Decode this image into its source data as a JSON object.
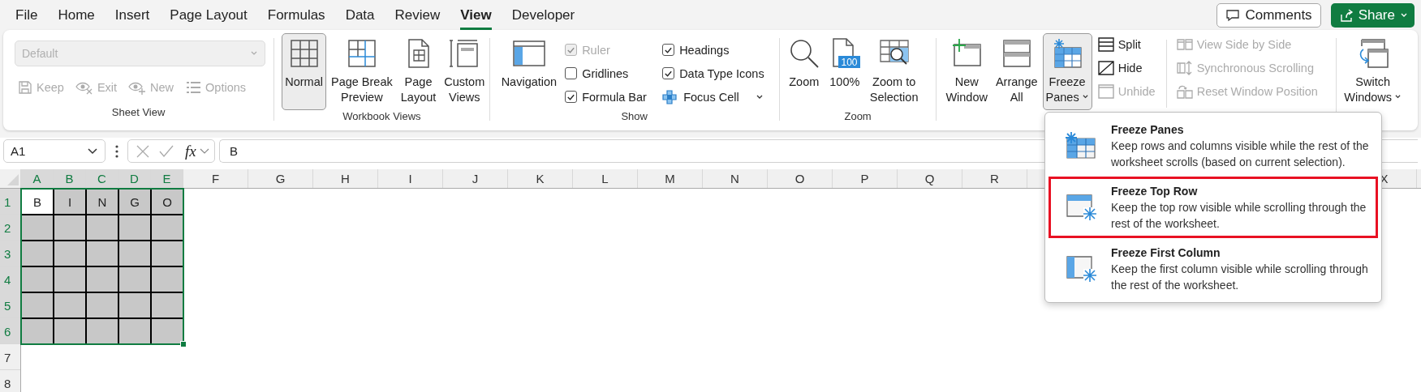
{
  "menu_tabs": [
    {
      "label": "File",
      "selected": false
    },
    {
      "label": "Home",
      "selected": false
    },
    {
      "label": "Insert",
      "selected": false
    },
    {
      "label": "Page Layout",
      "selected": false
    },
    {
      "label": "Formulas",
      "selected": false
    },
    {
      "label": "Data",
      "selected": false
    },
    {
      "label": "Review",
      "selected": false
    },
    {
      "label": "View",
      "selected": true
    },
    {
      "label": "Developer",
      "selected": false
    }
  ],
  "comments_button": {
    "label": "Comments"
  },
  "share_button": {
    "label": "Share"
  },
  "ribbon": {
    "sheet_view": {
      "label": "Sheet View",
      "dropdown": {
        "value": "Default",
        "disabled": true
      },
      "buttons": [
        {
          "label": "Keep",
          "disabled": true
        },
        {
          "label": "Exit",
          "disabled": true
        },
        {
          "label": "New",
          "disabled": true
        },
        {
          "label": "Options",
          "disabled": true
        }
      ]
    },
    "workbook_views": {
      "label": "Workbook Views",
      "buttons": [
        {
          "label": "Normal",
          "selected": true
        },
        {
          "label": "Page Break\nPreview",
          "selected": false
        },
        {
          "label": "Page\nLayout",
          "selected": false
        },
        {
          "label": "Custom\nViews",
          "selected": false
        }
      ]
    },
    "show": {
      "label": "Show",
      "navigation": {
        "label": "Navigation"
      },
      "checkboxes": [
        {
          "label": "Ruler",
          "checked": true,
          "disabled": true
        },
        {
          "label": "Gridlines",
          "checked": false,
          "disabled": false
        },
        {
          "label": "Formula Bar",
          "checked": true,
          "disabled": false
        },
        {
          "label": "Headings",
          "checked": true,
          "disabled": false
        },
        {
          "label": "Data Type Icons",
          "checked": true,
          "disabled": false
        }
      ],
      "focus_cell": {
        "label": "Focus Cell"
      }
    },
    "zoom": {
      "label": "Zoom",
      "buttons": [
        {
          "label": "Zoom"
        },
        {
          "label": "100%",
          "badge": "100"
        },
        {
          "label": "Zoom to\nSelection"
        }
      ]
    },
    "window": {
      "big_buttons": [
        {
          "label": "New\nWindow",
          "selected": false
        },
        {
          "label": "Arrange\nAll",
          "selected": false
        },
        {
          "label": "Freeze\nPanes",
          "selected": true
        }
      ],
      "small_buttons": [
        {
          "label": "Split",
          "disabled": false
        },
        {
          "label": "Hide",
          "disabled": false
        },
        {
          "label": "Unhide",
          "disabled": true
        },
        {
          "label": "View Side by Side",
          "disabled": true
        },
        {
          "label": "Synchronous Scrolling",
          "disabled": true
        },
        {
          "label": "Reset Window Position",
          "disabled": true
        }
      ],
      "switch_windows": {
        "label": "Switch\nWindows"
      }
    }
  },
  "formula_bar": {
    "name_box": "A1",
    "function_label": "fx",
    "formula": "B"
  },
  "sheet": {
    "columns": [
      {
        "label": "A",
        "selected": true
      },
      {
        "label": "B",
        "selected": true
      },
      {
        "label": "C",
        "selected": true
      },
      {
        "label": "D",
        "selected": true
      },
      {
        "label": "E",
        "selected": true
      },
      {
        "label": "F",
        "selected": false
      },
      {
        "label": "G",
        "selected": false
      },
      {
        "label": "H",
        "selected": false
      },
      {
        "label": "I",
        "selected": false
      },
      {
        "label": "J",
        "selected": false
      },
      {
        "label": "K",
        "selected": false
      },
      {
        "label": "L",
        "selected": false
      },
      {
        "label": "M",
        "selected": false
      },
      {
        "label": "N",
        "selected": false
      },
      {
        "label": "O",
        "selected": false
      },
      {
        "label": "P",
        "selected": false
      },
      {
        "label": "Q",
        "selected": false
      },
      {
        "label": "R",
        "selected": false
      },
      {
        "label": "X",
        "selected": false
      }
    ],
    "rows": [
      {
        "label": "1",
        "selected": true,
        "cells": [
          {
            "value": "B",
            "active": true
          },
          {
            "value": "I",
            "active": false
          },
          {
            "value": "N",
            "active": false
          },
          {
            "value": "G",
            "active": false
          },
          {
            "value": "O",
            "active": false
          }
        ]
      },
      {
        "label": "2",
        "selected": true,
        "cells": [
          {
            "active": false
          },
          {
            "active": false
          },
          {
            "active": false
          },
          {
            "active": false
          },
          {
            "active": false
          }
        ]
      },
      {
        "label": "3",
        "selected": true,
        "cells": [
          {
            "active": false
          },
          {
            "active": false
          },
          {
            "active": false
          },
          {
            "active": false
          },
          {
            "active": false
          }
        ]
      },
      {
        "label": "4",
        "selected": true,
        "cells": [
          {
            "active": false
          },
          {
            "active": false
          },
          {
            "active": false
          },
          {
            "active": false
          },
          {
            "active": false
          }
        ]
      },
      {
        "label": "5",
        "selected": true,
        "cells": [
          {
            "active": false
          },
          {
            "active": false
          },
          {
            "active": false
          },
          {
            "active": false
          },
          {
            "active": false
          }
        ]
      },
      {
        "label": "6",
        "selected": true,
        "cells": [
          {
            "active": false
          },
          {
            "active": false
          },
          {
            "active": false
          },
          {
            "active": false
          },
          {
            "active": false
          }
        ]
      },
      {
        "label": "7",
        "selected": false
      },
      {
        "label": "8",
        "selected": false
      }
    ]
  },
  "freeze_menu": {
    "items": [
      {
        "title": "Freeze Panes",
        "description": "Keep rows and columns visible while the rest of the worksheet scrolls (based on current selection).",
        "highlighted": false
      },
      {
        "title": "Freeze Top Row",
        "description": "Keep the top row visible while scrolling through the rest of the worksheet.",
        "highlighted": true
      },
      {
        "title": "Freeze First Column",
        "description": "Keep the first column visible while scrolling through the rest of the worksheet.",
        "highlighted": false
      }
    ]
  }
}
